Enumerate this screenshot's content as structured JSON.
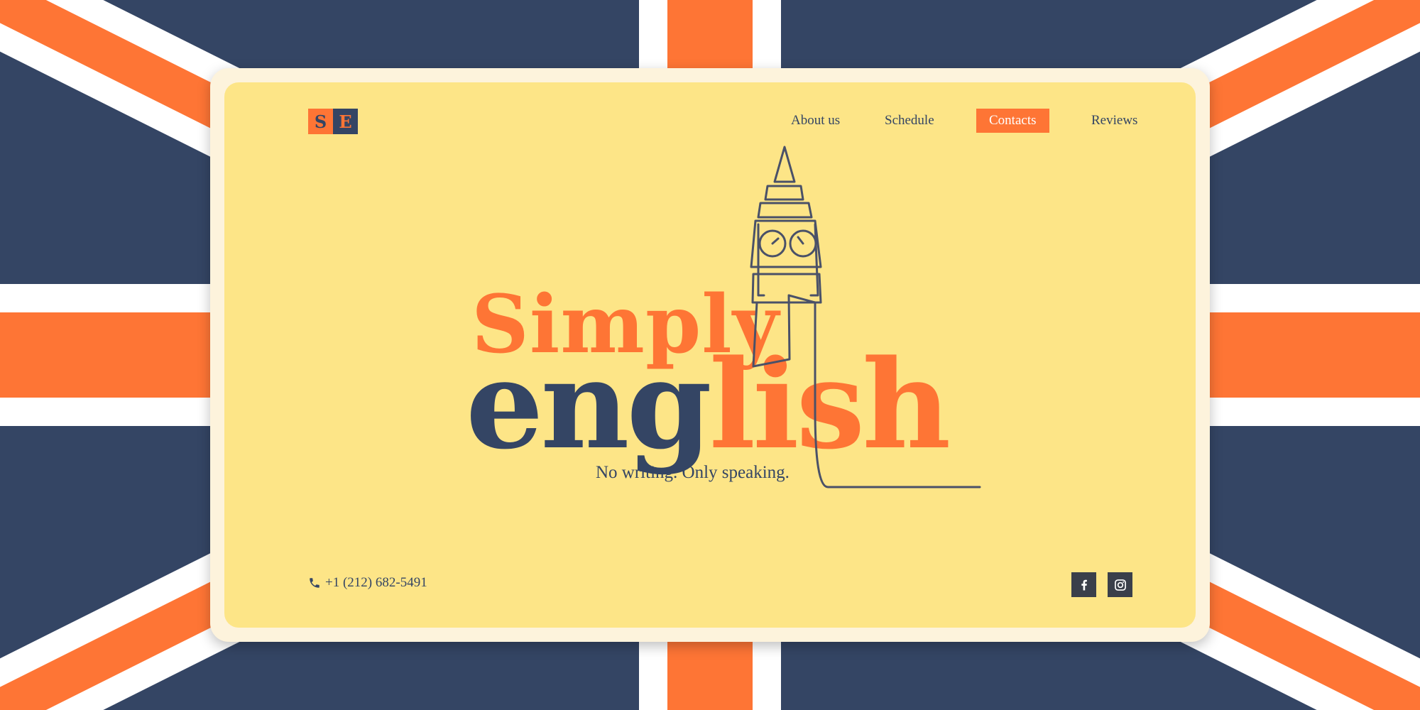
{
  "colors": {
    "navy": "#344564",
    "orange": "#FE7535",
    "yellow": "#FDE587",
    "cream": "#FDF3DC",
    "white": "#FFFFFF",
    "social_bg": "#3A3F4A"
  },
  "logo": {
    "letter1": "S",
    "letter2": "E"
  },
  "nav": {
    "items": [
      {
        "label": "About us",
        "active": false
      },
      {
        "label": "Schedule",
        "active": false
      },
      {
        "label": "Contacts",
        "active": true
      },
      {
        "label": "Reviews",
        "active": false
      }
    ]
  },
  "hero": {
    "word1": "Simply",
    "word2": "english",
    "tagline": "No writing. Only speaking.",
    "illustration": "big-ben-line-drawing"
  },
  "footer": {
    "phone": "+1 (212) 682-5491",
    "phone_icon": "phone-icon",
    "social": [
      "facebook-icon",
      "instagram-icon"
    ]
  },
  "background": "union-jack-flag"
}
